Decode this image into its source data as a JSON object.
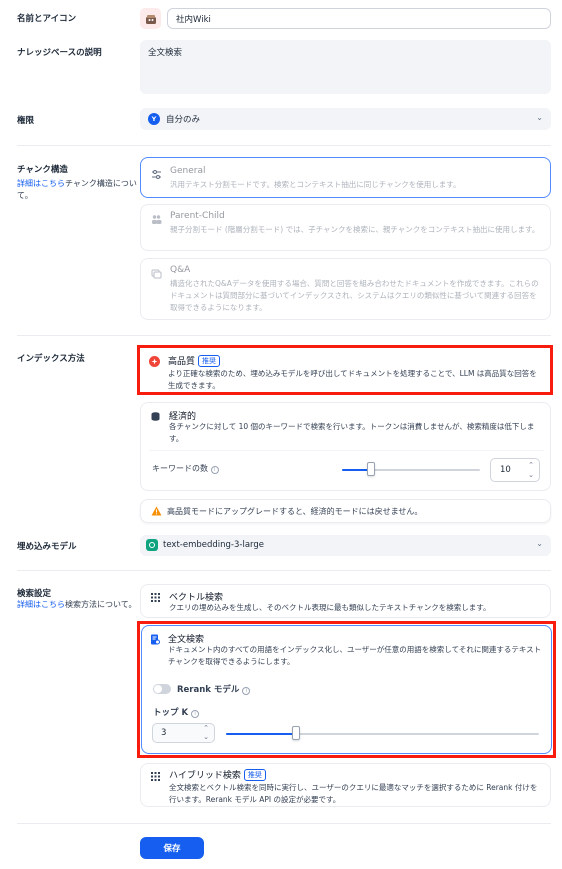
{
  "name_icon": {
    "label": "名前とアイコン",
    "value": "社内Wiki"
  },
  "description": {
    "label": "ナレッジベースの説明",
    "value": "全文検索"
  },
  "permission": {
    "label": "権限",
    "avatar": "Y",
    "value": "自分のみ"
  },
  "chunk": {
    "label": "チャンク構造",
    "link": "詳細はこちら",
    "sub": "チャンク構造について。",
    "options": [
      {
        "title": "General",
        "desc": "汎用テキスト分割モードです。検索とコンテキスト抽出に同じチャンクを使用します。",
        "icon": "sliders-icon"
      },
      {
        "title": "Parent-Child",
        "desc": "親子分割モード (階層分割モード) では、子チャンクを検索に、親チャンクをコンテキスト抽出に使用します。",
        "icon": "people-icon"
      },
      {
        "title": "Q&A",
        "desc": "構造化されたQ&Aデータを使用する場合、質問と回答を組み合わせたドキュメントを作成できます。これらのドキュメントは質問部分に基づいてインデックスされ、システムはクエリの類似性に基づいて関連する回答を取得できるようになります。",
        "icon": "qa-icon"
      }
    ]
  },
  "index": {
    "label": "インデックス方法",
    "high_quality": {
      "title": "高品質",
      "badge": "推奨",
      "desc": "より正確な検索のため、埋め込みモデルを呼び出してドキュメントを処理することで、LLM は高品質な回答を生成できます。"
    },
    "economic": {
      "title": "経済的",
      "desc": "各チャンクに対して 10 個のキーワードで検索を行います。トークンは消費しませんが、検索精度は低下します。",
      "keyword_label": "キーワードの数",
      "keyword_value": "10"
    },
    "warning": "高品質モードにアップグレードすると、経済的モードには戻せません。"
  },
  "embedding": {
    "label": "埋め込みモデル",
    "value": "text-embedding-3-large"
  },
  "retrieval": {
    "label": "検索設定",
    "link": "詳細はこちら",
    "sub": "検索方法について。",
    "vector": {
      "title": "ベクトル検索",
      "desc": "クエリの埋め込みを生成し、そのベクトル表現に最も類似したテキストチャンクを検索します。"
    },
    "fulltext": {
      "title": "全文検索",
      "desc": "ドキュメント内のすべての用語をインデックス化し、ユーザーが任意の用語を検索してそれに関連するテキストチャンクを取得できるようにします。",
      "rerank_label": "Rerank モデル",
      "topk_label": "トップ K",
      "topk_value": "3"
    },
    "hybrid": {
      "title": "ハイブリッド検索",
      "badge": "推奨",
      "desc": "全文検索とベクトル検索を同時に実行し、ユーザーのクエリに最適なマッチを選択するために Rerank 付けを行います。Rerank モデル API の設定が必要です。"
    }
  },
  "save_label": "保存",
  "colors": {
    "accent": "#155eef",
    "highlight": "#f71c0e",
    "warning": "#f79009"
  }
}
